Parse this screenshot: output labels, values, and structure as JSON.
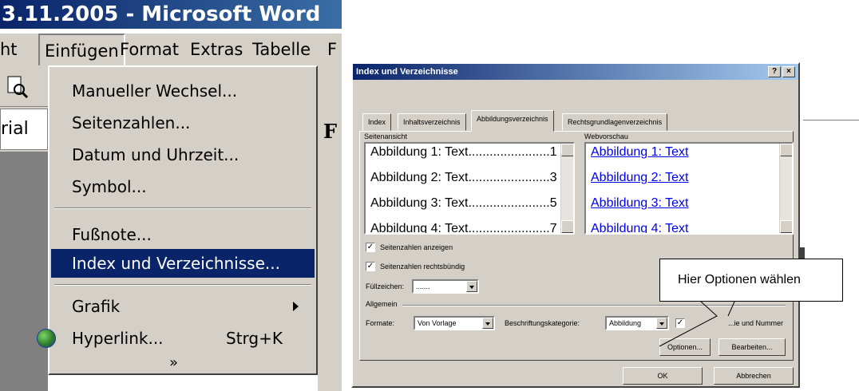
{
  "word": {
    "title": "3.11.2005 - Microsoft Word",
    "menubar": [
      "ht",
      "Einfügen",
      "Format",
      "Extras",
      "Tabelle",
      "F"
    ],
    "font_box": "rial",
    "bold_button": "F"
  },
  "menu": {
    "items": [
      {
        "label": "Manueller Wechsel..."
      },
      {
        "label": "Seitenzahlen..."
      },
      {
        "label": "Datum und Uhrzeit..."
      },
      {
        "label": "Symbol..."
      },
      {
        "label": "Fußnote..."
      },
      {
        "label": "Index und Verzeichnisse...",
        "selected": true
      },
      {
        "label": "Grafik",
        "submenu": true
      },
      {
        "label": "Hyperlink...",
        "shortcut": "Strg+K",
        "icon": "globe-icon"
      }
    ],
    "expand_icon": "»"
  },
  "dialog": {
    "title": "Index und Verzeichnisse",
    "title_buttons": [
      "?",
      "×"
    ],
    "tabs": [
      "Index",
      "Inhaltsverzeichnis",
      "Abbildungsverzeichnis",
      "Rechtsgrundlagenverzeichnis"
    ],
    "active_tab": "Abbildungsverzeichnis",
    "print_preview_label": "Seitenansicht",
    "web_preview_label": "Webvorschau",
    "print_preview_rows": [
      "Abbildung 1: Text.......................1",
      "Abbildung 2: Text.......................3",
      "Abbildung 3: Text.......................5",
      "Abbildung 4: Text.......................7"
    ],
    "web_preview_rows": [
      "Abbildung 1: Text",
      "Abbildung 2: Text",
      "Abbildung 3: Text",
      "Abbildung 4: Text"
    ],
    "show_page_numbers": {
      "label": "Seitenzahlen anzeigen",
      "checked": true
    },
    "right_align": {
      "label": "Seitenzahlen rechtsbündig",
      "checked": true
    },
    "fill_char_label": "Füllzeichen:",
    "fill_char_value": ".......",
    "general_label": "Allgemein",
    "formats_label": "Formate:",
    "formats_value": "Von Vorlage",
    "caption_label": "Beschriftungskategorie:",
    "caption_value": "Abbildung",
    "label_number": {
      "label": "...ie und Nummer",
      "checked": true
    },
    "options_button": "Optionen...",
    "edit_button": "Bearbeiten...",
    "ok_button": "OK",
    "cancel_button": "Abbrechen"
  },
  "callout": "Hier Optionen wählen"
}
